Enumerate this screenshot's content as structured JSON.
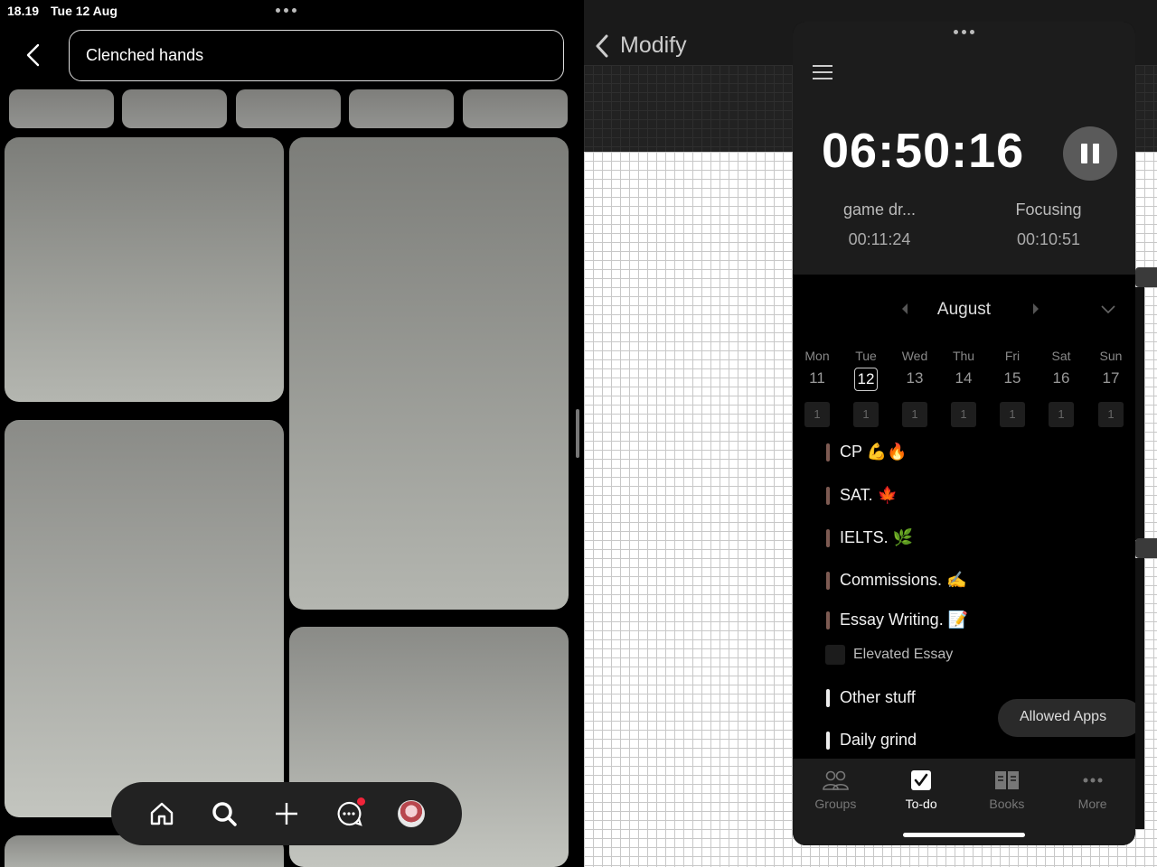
{
  "status_bar": {
    "time": "18.19",
    "date": "Tue 12 Aug"
  },
  "left_app": {
    "search_value": "Clenched hands",
    "dock": [
      "home-icon",
      "search-icon",
      "plus-icon",
      "messages-icon",
      "profile-avatar"
    ]
  },
  "right_app": {
    "title": "Modify"
  },
  "focus_panel": {
    "timer": "06:50:16",
    "left_session": {
      "label": "game dr...",
      "time": "00:11:24"
    },
    "right_session": {
      "label": "Focusing",
      "time": "00:10:51"
    },
    "month": "August",
    "week": [
      {
        "name": "Mon",
        "date": "11",
        "count": "1"
      },
      {
        "name": "Tue",
        "date": "12",
        "count": "1",
        "today": true
      },
      {
        "name": "Wed",
        "date": "13",
        "count": "1"
      },
      {
        "name": "Thu",
        "date": "14",
        "count": "1"
      },
      {
        "name": "Fri",
        "date": "15",
        "count": "1"
      },
      {
        "name": "Sat",
        "date": "16",
        "count": "1"
      },
      {
        "name": "Sun",
        "date": "17",
        "count": "1"
      }
    ],
    "tasks": [
      {
        "label": "CP 💪🔥"
      },
      {
        "label": "SAT. 🍁"
      },
      {
        "label": "IELTS. 🌿"
      },
      {
        "label": "Commissions. ✍️"
      },
      {
        "label": "Essay Writing. 📝"
      },
      {
        "label": "Other stuff"
      },
      {
        "label": "Daily grind"
      }
    ],
    "subtask": "Elevated Essay",
    "allowed_apps": "Allowed Apps",
    "tabs": [
      {
        "label": "Groups",
        "icon": "groups-icon"
      },
      {
        "label": "To-do",
        "icon": "todo-icon",
        "active": true
      },
      {
        "label": "Books",
        "icon": "books-icon"
      },
      {
        "label": "More",
        "icon": "more-icon"
      }
    ]
  }
}
